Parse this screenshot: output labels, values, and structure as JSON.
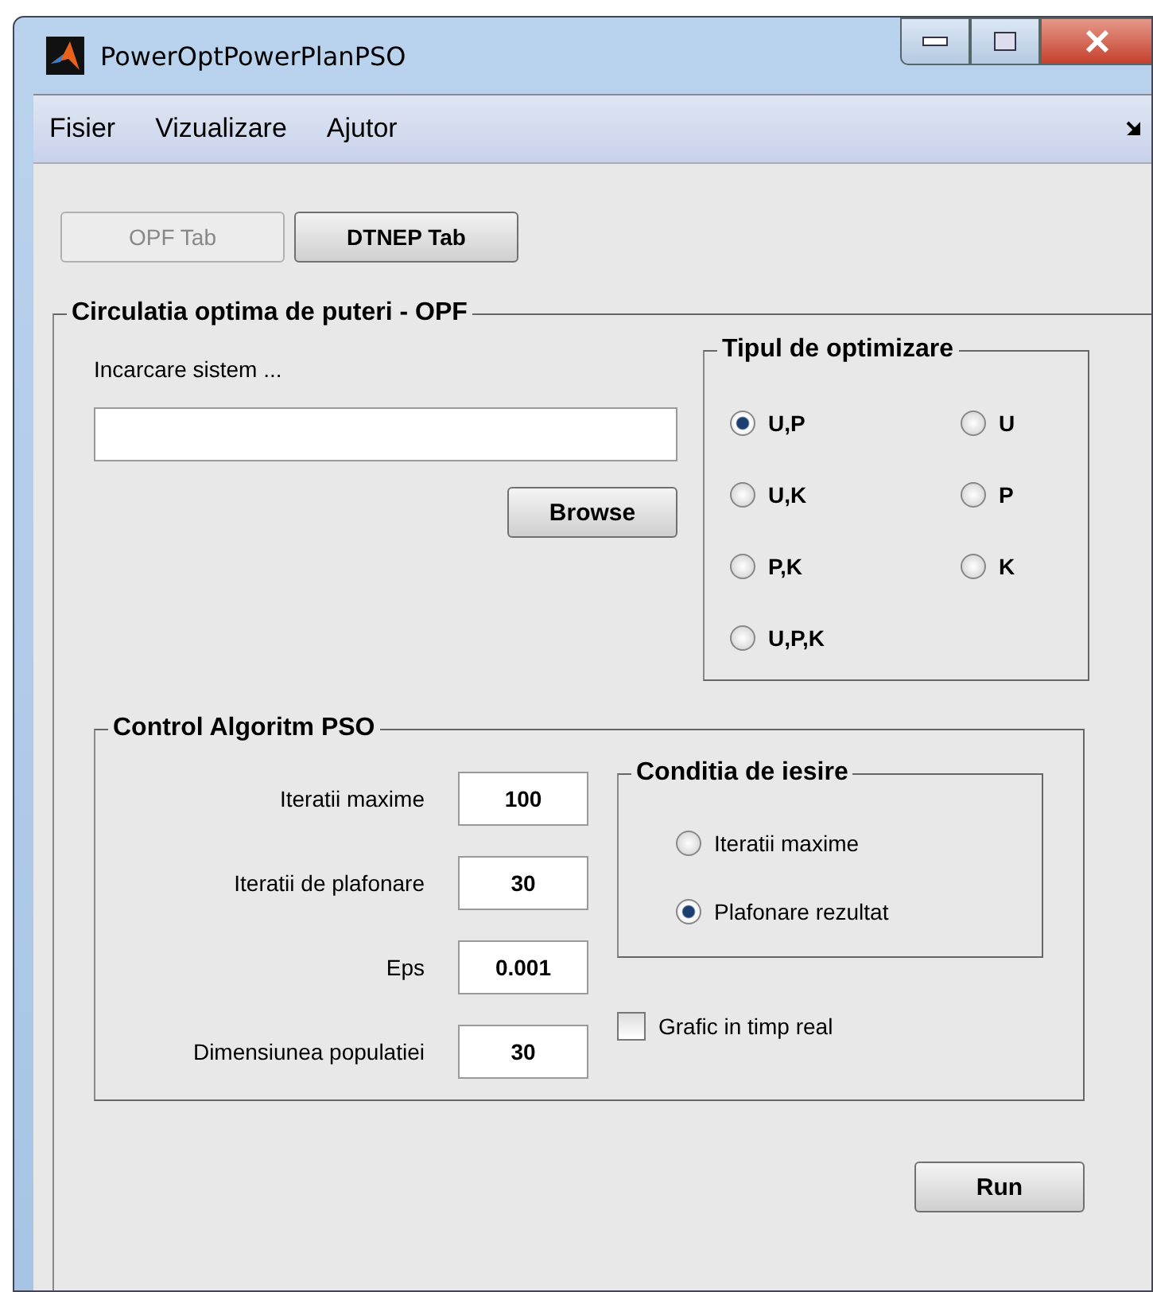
{
  "window": {
    "title": "PowerOptPowerPlanPSO"
  },
  "menu": [
    "Fisier",
    "Vizualizare",
    "Ajutor"
  ],
  "tabs": [
    {
      "label": "OPF Tab",
      "selected": true
    },
    {
      "label": "DTNEP Tab",
      "selected": false
    }
  ],
  "opf_panel": {
    "title": "Circulatia optima de puteri - OPF",
    "load_label": "Incarcare sistem ...",
    "browse_button": "Browse",
    "optimization": {
      "title": "Tipul de optimizare",
      "options": [
        {
          "label": "U,P",
          "selected": true
        },
        {
          "label": "U",
          "selected": false
        },
        {
          "label": "U,K",
          "selected": false
        },
        {
          "label": "P",
          "selected": false
        },
        {
          "label": "P,K",
          "selected": false
        },
        {
          "label": "K",
          "selected": false
        },
        {
          "label": "U,P,K",
          "selected": false
        }
      ]
    },
    "pso": {
      "title": "Control Algoritm PSO",
      "fields": [
        {
          "label": "Iteratii maxime",
          "value": "100"
        },
        {
          "label": "Iteratii de plafonare",
          "value": "30"
        },
        {
          "label": "Eps",
          "value": "0.001"
        },
        {
          "label": "Dimensiunea populatiei",
          "value": "30"
        }
      ],
      "exit": {
        "title": "Conditia de iesire",
        "options": [
          {
            "label": "Iteratii maxime",
            "selected": false
          },
          {
            "label": "Plafonare rezultat",
            "selected": true
          }
        ]
      },
      "realtime": {
        "label": "Grafic in timp real",
        "checked": false
      }
    },
    "run_button": "Run"
  }
}
